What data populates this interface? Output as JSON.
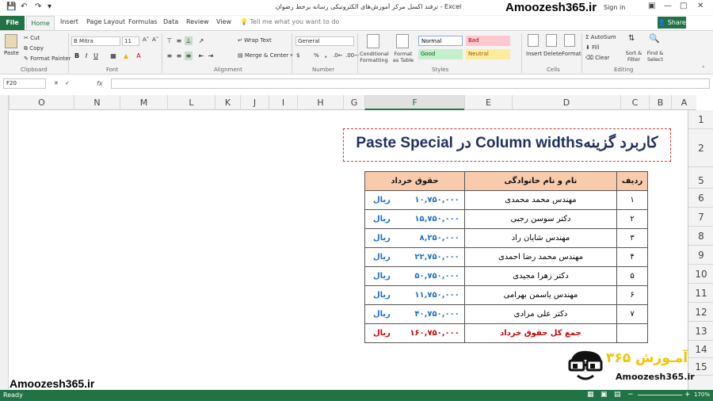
{
  "titlebar": {
    "doc_title": "ترفند اکسل مرکز آموزش‌های الکترونیکی رسانه برخط رضوان - Excel",
    "brand": "Amoozesh365.ir",
    "signin": "Sign in"
  },
  "tabs": [
    "File",
    "Home",
    "Insert",
    "Page Layout",
    "Formulas",
    "Data",
    "Review",
    "View"
  ],
  "tell_me": "Tell me what you want to do",
  "share": "Share",
  "ribbon": {
    "clipboard": {
      "paste": "Paste",
      "cut": "Cut",
      "copy": "Copy",
      "format_painter": "Format Painter",
      "group": "Clipboard"
    },
    "font": {
      "name": "B Mitra",
      "size": "11",
      "group": "Font"
    },
    "alignment": {
      "wrap": "Wrap Text",
      "merge": "Merge & Center",
      "group": "Alignment"
    },
    "number": {
      "format": "General",
      "group": "Number"
    },
    "styles": {
      "conditional": "Conditional Formatting",
      "format_table": "Format as Table",
      "normal": "Normal",
      "bad": "Bad",
      "good": "Good",
      "neutral": "Neutral",
      "group": "Styles"
    },
    "cells": {
      "insert": "Insert",
      "delete": "Delete",
      "format": "Format",
      "group": "Cells"
    },
    "editing": {
      "autosum": "AutoSum",
      "fill": "Fill",
      "clear": "Clear",
      "sort": "Sort & Filter",
      "find": "Find & Select",
      "group": "Editing"
    }
  },
  "name_box": "F20",
  "fx": "fx",
  "columns": [
    "O",
    "N",
    "M",
    "L",
    "K",
    "J",
    "I",
    "H",
    "G",
    "F",
    "E",
    "D",
    "C",
    "B",
    "A"
  ],
  "rows": [
    "1",
    "2",
    "5",
    "6",
    "7",
    "8",
    "9",
    "10",
    "11",
    "12",
    "13",
    "14",
    "15"
  ],
  "heading": "کاربرد گزینه‌Column widths در  Paste Special",
  "table": {
    "headers": [
      "حقوق خرداد",
      "نام و نام خانوادگی",
      "ردیف"
    ],
    "currency": "ریال",
    "rows": [
      {
        "salary": "۱۰,۷۵۰,۰۰۰",
        "name": "مهندس محمد محمدی",
        "idx": "۱"
      },
      {
        "salary": "۱۵,۷۵۰,۰۰۰",
        "name": "دکتر سوسن رجبی",
        "idx": "۲"
      },
      {
        "salary": "۸,۲۵۰,۰۰۰",
        "name": "مهندس شایان راد",
        "idx": "۳"
      },
      {
        "salary": "۲۲,۷۵۰,۰۰۰",
        "name": "مهندس محمد رضا احمدی",
        "idx": "۴"
      },
      {
        "salary": "۵۰,۷۵۰,۰۰۰",
        "name": "دکتر زهرا مجیدی",
        "idx": "۵"
      },
      {
        "salary": "۱۱,۷۵۰,۰۰۰",
        "name": "مهندس یاسمن بهرامی",
        "idx": "۶"
      },
      {
        "salary": "۴۰,۷۵۰,۰۰۰",
        "name": "دکتر علی مرادی",
        "idx": "۷"
      }
    ],
    "total": {
      "salary": "۱۶۰,۷۵۰,۰۰۰",
      "label": "جمع کل حقوق خرداد"
    }
  },
  "brand_bottom": "Amoozesh365.ir",
  "logo": {
    "fa": "آمـوزش ۳۶۵",
    "en": "Amoozesh365.ir"
  },
  "status": {
    "ready": "Ready",
    "zoom": "170%"
  },
  "colors": {
    "excel_green": "#217346",
    "header_fill": "#f8cbad",
    "salary_blue": "#1e6fc8",
    "total_red": "#d00000"
  }
}
